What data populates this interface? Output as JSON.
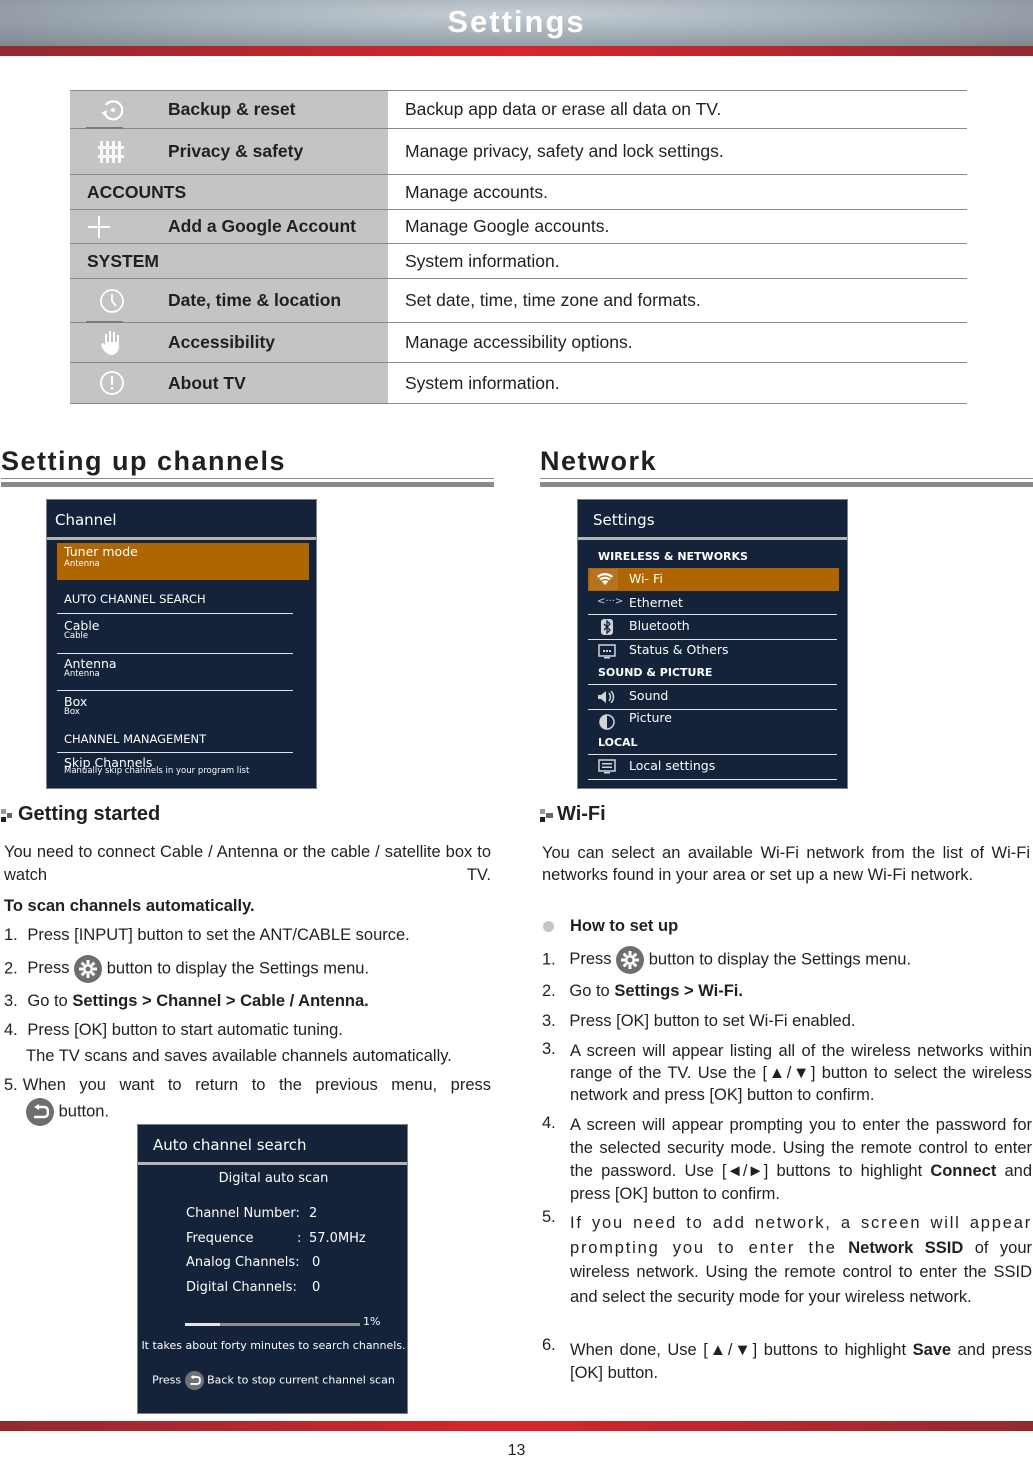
{
  "header": {
    "title": "Settings"
  },
  "settings_table": [
    {
      "type": "item",
      "icon": "backup-reset-icon",
      "label": "Backup & reset",
      "description": "Backup app data or erase all data on TV."
    },
    {
      "type": "item",
      "icon": "privacy-fence-icon",
      "label": "Privacy & safety",
      "description": "Manage privacy, safety and lock settings."
    },
    {
      "type": "header",
      "label": "ACCOUNTS",
      "description": "Manage accounts."
    },
    {
      "type": "item",
      "icon": "plus-icon",
      "label": "Add a Google Account",
      "description": "Manage Google accounts."
    },
    {
      "type": "header",
      "label": "SYSTEM",
      "description": "System information."
    },
    {
      "type": "item",
      "icon": "clock-icon",
      "label": "Date, time & location",
      "description": "Set date, time, time zone and formats."
    },
    {
      "type": "item",
      "icon": "hand-icon",
      "label": "Accessibility",
      "description": "Manage accessibility options."
    },
    {
      "type": "item",
      "icon": "info-exclamation-icon",
      "label": "About TV",
      "description": "System information."
    }
  ],
  "channels": {
    "section_title": "Setting up channels",
    "panel": {
      "title": "Channel",
      "tuner_mode": {
        "label": "Tuner mode",
        "value": "Antenna"
      },
      "auto_search_header": "AUTO CHANNEL SEARCH",
      "items": [
        {
          "label": "Cable",
          "sub": "Cable"
        },
        {
          "label": "Antenna",
          "sub": "Antenna"
        },
        {
          "label": "Box",
          "sub": "Box"
        }
      ],
      "management_header": "CHANNEL MANAGEMENT",
      "skip": {
        "label": "Skip Channels",
        "sub": "Manually skip channels in your program list"
      }
    },
    "getting_started": {
      "heading": "Getting started",
      "intro": "You need to connect Cable / Antenna or the cable / satellite box to watch TV.",
      "subheading": "To scan channels automatically.",
      "steps": [
        {
          "num": "1.",
          "text": "Press [INPUT] button to set the ANT/CABLE source."
        },
        {
          "num": "2.",
          "pre": "Press",
          "post": "button to display the Settings menu."
        },
        {
          "num": "3.",
          "pre": "Go to",
          "bold": "Settings > Channel > Cable / Antenna."
        },
        {
          "num": "4.",
          "text": "Press [OK] button to start automatic tuning.",
          "text2": "The TV scans and saves available channels automatically."
        },
        {
          "num": "5.",
          "text": "When you want to return to the previous menu, press",
          "post": "button."
        }
      ]
    },
    "scan_panel": {
      "title": "Auto channel search",
      "subtitle": "Digital auto scan",
      "fields": [
        {
          "label": "Channel Number:",
          "value": "2"
        },
        {
          "label": "Frequence",
          "sep": ":",
          "value": "57.0MHz"
        },
        {
          "label": "Analog Channels:",
          "value": "0"
        },
        {
          "label": "Digital Channels:",
          "value": "0"
        }
      ],
      "progress_percent": 1,
      "progress_label": "1%",
      "note": "It takes about forty minutes to search channels.",
      "stop_pre": "Press",
      "stop_post": "Back to stop current channel scan"
    }
  },
  "network": {
    "section_title": "Network",
    "panel": {
      "title": "Settings",
      "categories": [
        {
          "label": "WIRELESS & NETWORKS",
          "items": [
            {
              "icon": "wifi-icon",
              "label": "Wi- Fi",
              "selected": true
            },
            {
              "icon": "ethernet-icon",
              "label": "Ethernet"
            },
            {
              "icon": "bluetooth-icon",
              "label": "Bluetooth"
            },
            {
              "icon": "status-others-icon",
              "label": "Status & Others"
            }
          ]
        },
        {
          "label": "SOUND & PICTURE",
          "items": [
            {
              "icon": "sound-icon",
              "label": "Sound"
            },
            {
              "icon": "picture-icon",
              "label": "Picture"
            }
          ]
        },
        {
          "label": "LOCAL",
          "items": [
            {
              "icon": "local-settings-icon",
              "label": "Local settings"
            }
          ]
        }
      ]
    },
    "wifi": {
      "heading": "Wi-Fi",
      "intro": "You can select an available Wi-Fi network from the list of Wi-Fi networks found in your area or set up a new Wi-Fi network.",
      "how_to": "How to set up",
      "steps": [
        {
          "num": "1.",
          "pre": "Press",
          "post": "button to display the Settings menu."
        },
        {
          "num": "2.",
          "pre": "Go to",
          "bold": "Settings > Wi-Fi."
        },
        {
          "num": "3.",
          "text": "Press [OK] button to set Wi-Fi enabled."
        },
        {
          "num": "3.",
          "text": "A screen will appear listing all of the wireless networks within range of the TV. Use the [▲/▼] button to select the wireless network and press [OK] button to confirm."
        },
        {
          "num": "4.",
          "text": "A screen will appear prompting you to enter the password for the selected security mode. Using the remote control to enter the password. Use [◄/►] buttons to highlight",
          "bold": "Connect",
          "post": "and press [OK] button to confirm."
        },
        {
          "num": "5.",
          "text": "If you need to add network, a screen will appear prompting you to enter the",
          "bold": "Network SSID",
          "post": "of your wireless network. Using the remote control to enter the SSID and select the security mode for your wireless network."
        },
        {
          "num": "6.",
          "text": "When done, Use [▲/▼] buttons to highlight",
          "bold": "Save",
          "post": "and press [OK] button."
        }
      ]
    }
  },
  "footer": {
    "page_number": "13"
  },
  "colors": {
    "highlight": "#b06600",
    "panel_bg": "#14223a",
    "accent_red": "#d8252c",
    "table_gray": "#c3c4c6"
  }
}
